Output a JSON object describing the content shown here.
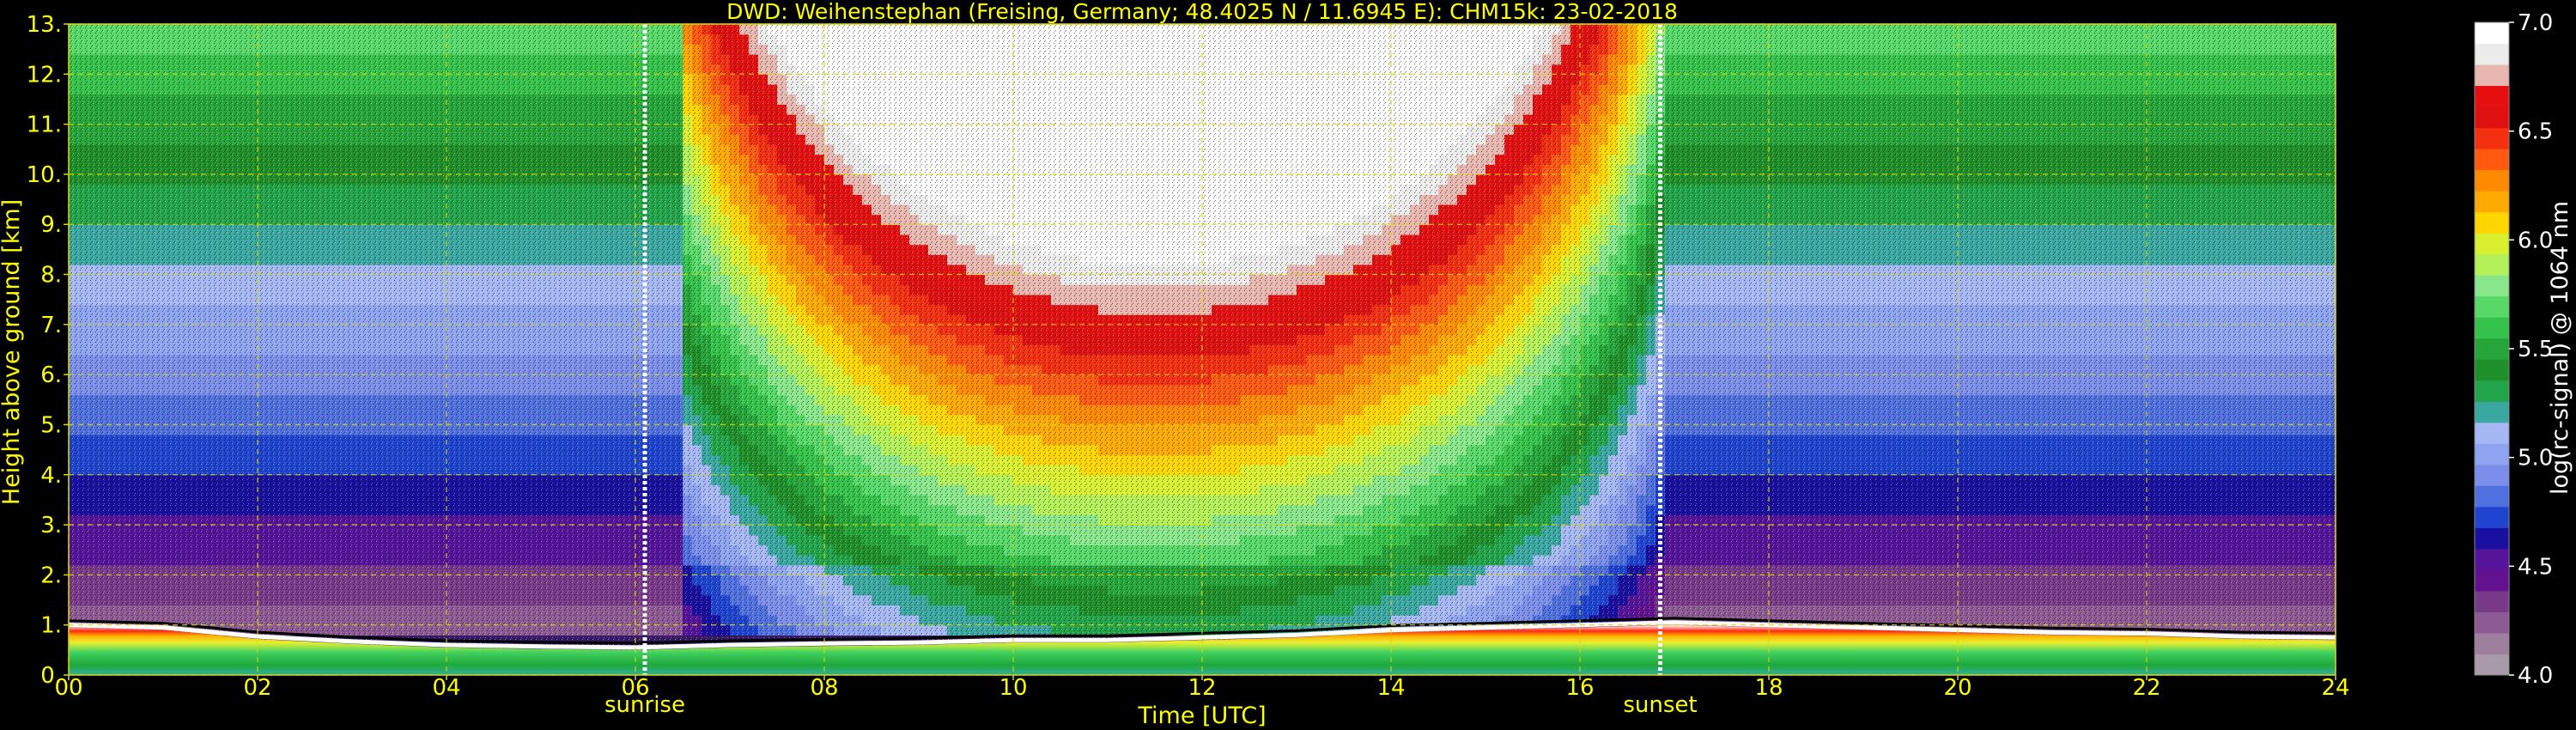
{
  "chart_data": {
    "type": "heatmap",
    "title": "DWD: Weihenstephan (Freising, Germany; 48.4025 N / 11.6945 E):    CHM15k: 23-02-2018",
    "xlabel": "Time [UTC]",
    "ylabel": "Height above ground [km]",
    "xlim": [
      0,
      24
    ],
    "ylim": [
      0,
      13
    ],
    "x_ticks": [
      "00",
      "02",
      "04",
      "06",
      "08",
      "10",
      "12",
      "14",
      "16",
      "18",
      "20",
      "22",
      "24"
    ],
    "x_tick_values": [
      0,
      2,
      4,
      6,
      8,
      10,
      12,
      14,
      16,
      18,
      20,
      22,
      24
    ],
    "y_ticks": [
      "0.",
      "1.",
      "2.",
      "3.",
      "4.",
      "5.",
      "6.",
      "7.",
      "8.",
      "9.",
      "10.",
      "11.",
      "12.",
      "13."
    ],
    "y_tick_values": [
      0,
      1,
      2,
      3,
      4,
      5,
      6,
      7,
      8,
      9,
      10,
      11,
      12,
      13
    ],
    "grid": true,
    "annotations": [
      {
        "label": "sunrise",
        "time": 6.1
      },
      {
        "label": "sunset",
        "time": 16.85
      }
    ],
    "colorbar": {
      "label": "log(rc-signal) @ 1064 nm",
      "range": [
        4.0,
        7.0
      ],
      "ticks": [
        "4.0",
        "4.5",
        "5.0",
        "5.5",
        "6.0",
        "6.5",
        "7.0"
      ],
      "tick_values": [
        4.0,
        4.5,
        5.0,
        5.5,
        6.0,
        6.5,
        7.0
      ],
      "colors": [
        "#a89aa8",
        "#9e7f9e",
        "#8d5a94",
        "#7a3a8a",
        "#63128f",
        "#55149a",
        "#1a10a0",
        "#1f45d0",
        "#5070e0",
        "#7b8fea",
        "#8fa4f0",
        "#a6b8f4",
        "#3aa7a0",
        "#21a44a",
        "#1f8f2a",
        "#26a63a",
        "#35c24a",
        "#59d86a",
        "#8ae68a",
        "#b4f05a",
        "#d8f030",
        "#ffd600",
        "#ffaa00",
        "#ff8a00",
        "#ff5a10",
        "#f53010",
        "#e01010",
        "#e60f0f",
        "#e8b8b0",
        "#ececec",
        "#ffffff"
      ]
    },
    "features": {
      "boundary_layer_top_km": [
        [
          0,
          0.95
        ],
        [
          1,
          0.9
        ],
        [
          2,
          0.72
        ],
        [
          3,
          0.62
        ],
        [
          4,
          0.55
        ],
        [
          5,
          0.52
        ],
        [
          6,
          0.5
        ],
        [
          7,
          0.55
        ],
        [
          8,
          0.58
        ],
        [
          9,
          0.6
        ],
        [
          10,
          0.65
        ],
        [
          11,
          0.65
        ],
        [
          12,
          0.7
        ],
        [
          13,
          0.75
        ],
        [
          14,
          0.85
        ],
        [
          15,
          0.9
        ],
        [
          16,
          0.95
        ],
        [
          17,
          1.0
        ],
        [
          18,
          0.95
        ],
        [
          19,
          0.9
        ],
        [
          20,
          0.85
        ],
        [
          21,
          0.8
        ],
        [
          22,
          0.78
        ],
        [
          23,
          0.72
        ],
        [
          24,
          0.7
        ]
      ],
      "daytime_signal_peak": {
        "time": 12,
        "value": 6.6
      }
    }
  }
}
